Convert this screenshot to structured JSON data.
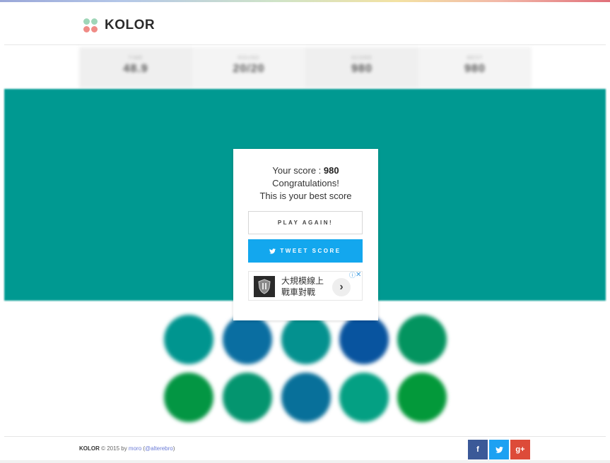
{
  "header": {
    "brand": "KOLOR",
    "logo_colors": [
      "#9fd6b8",
      "#9fd6b8",
      "#f08b86",
      "#f08b86"
    ]
  },
  "stats": [
    {
      "label": "TIME",
      "value": "48.9"
    },
    {
      "label": "ROUND",
      "value": "20/20"
    },
    {
      "label": "SCORE",
      "value": "980"
    },
    {
      "label": "BEST",
      "value": "980"
    }
  ],
  "board": {
    "color": "#009991"
  },
  "tiles": [
    "#00958f",
    "#0a6ea1",
    "#04918f",
    "#08549f",
    "#03945f",
    "#039643",
    "#04956f",
    "#08709a",
    "#04a083",
    "#03993a"
  ],
  "modal": {
    "score_prefix": "Your score : ",
    "score_value": "980",
    "line1": "Congratulations!",
    "line2": "This is your best score",
    "play_again": "PLAY AGAIN!",
    "tweet": "TWEET SCORE"
  },
  "ad": {
    "line1": "大規模線上",
    "line2": "戰車對戰",
    "arrow": "›",
    "info": "ⓘ",
    "close": "✕"
  },
  "footer": {
    "brand": "KOLOR",
    "copyright": " © 2015 by ",
    "author": "moro",
    "handle_open": " (",
    "handle": "@alterebro",
    "handle_close": ")",
    "social": [
      {
        "name": "facebook",
        "label": "f",
        "color": "#3b5998"
      },
      {
        "name": "twitter",
        "label": "t",
        "color": "#1da1f2"
      },
      {
        "name": "google-plus",
        "label": "g+",
        "color": "#dd4b39"
      }
    ]
  }
}
